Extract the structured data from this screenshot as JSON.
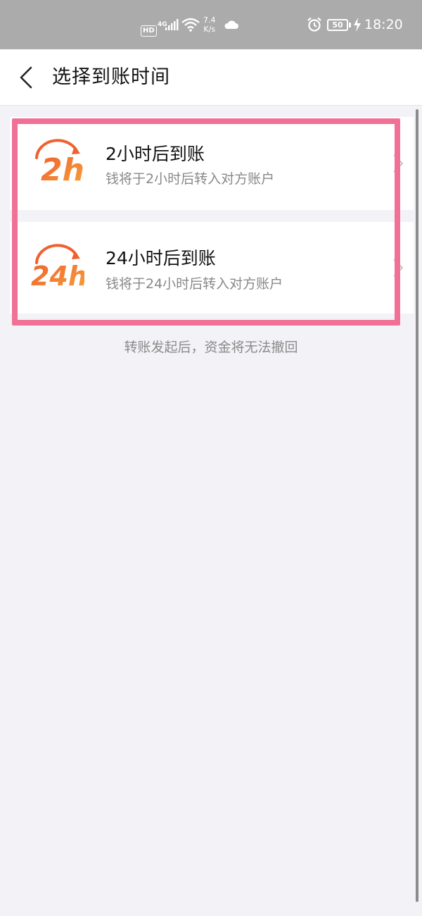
{
  "status_bar": {
    "hd": "HD",
    "network": "4G",
    "speed_value": "7.4",
    "speed_unit": "K/s",
    "battery": "50",
    "time": "18:20"
  },
  "header": {
    "title": "选择到账时间"
  },
  "options": [
    {
      "icon_text": "2h",
      "title": "2小时后到账",
      "subtitle": "钱将于2小时后转入对方账户"
    },
    {
      "icon_text": "24h",
      "title": "24小时后到账",
      "subtitle": "钱将于24小时后转入对方账户"
    }
  ],
  "note": "转账发起后，资金将无法撤回",
  "colors": {
    "status_bar_bg": "#ababab",
    "page_bg": "#f3f3f7",
    "icon_orange": "#f0602f",
    "icon_gold": "#f6a13a",
    "highlight": "#f07096"
  }
}
